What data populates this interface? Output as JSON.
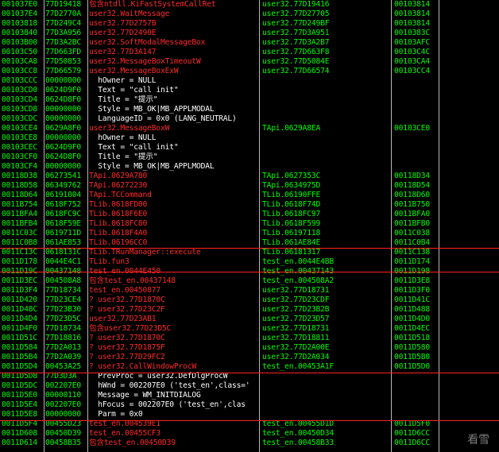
{
  "watermark": "看雪",
  "rows": [
    {
      "addr": "001037E0",
      "val": "77D19418",
      "com": "包含ntdll.KiFastSystemCallRet",
      "cc": "red",
      "proc": "user32.77D19416",
      "frame": "00103814"
    },
    {
      "addr": "001037E4",
      "val": "77D2770A",
      "com": "user32.WaitMessage",
      "cc": "red",
      "proc": "user32.77D27705",
      "frame": "00103814"
    },
    {
      "addr": "00103818",
      "val": "77D249C4",
      "com": "user32.77D2757B",
      "cc": "red",
      "proc": "user32.77D249BF",
      "frame": "00103814"
    },
    {
      "addr": "00103840",
      "val": "77D3A956",
      "com": "user32.77D2490E",
      "cc": "red",
      "proc": "user32.77D3A951",
      "frame": "0010383C"
    },
    {
      "addr": "00103B00",
      "val": "77D3A2BC",
      "com": "user32.SoftModalMessageBox",
      "cc": "red",
      "proc": "user32.77D3A2B7",
      "frame": "00103AFC"
    },
    {
      "addr": "00103C50",
      "val": "77D663FD",
      "com": "user32.77D3A147",
      "cc": "red",
      "proc": "user32.77D663F8",
      "frame": "00103C4C"
    },
    {
      "addr": "00103CA8",
      "val": "77D50853",
      "com": "user32.MessageBoxTimeoutW",
      "cc": "red",
      "proc": "user32.77D5084E",
      "frame": "00103CA4"
    },
    {
      "addr": "00103CC8",
      "val": "77D66579",
      "com": "user32.MessageBoxExW",
      "cc": "red",
      "proc": "user32.77D66574",
      "frame": "00103CC4"
    },
    {
      "addr": "00103CCC",
      "val": "00000000",
      "com": "  hOwner = NULL",
      "cc": "wht",
      "proc": "",
      "frame": ""
    },
    {
      "addr": "00103CD0",
      "val": "0624D9F0",
      "com": "  Text = \"call init\"",
      "cc": "wht",
      "proc": "",
      "frame": ""
    },
    {
      "addr": "00103CD4",
      "val": "0624D8F0",
      "com": "  Title = \"提示\"",
      "cc": "wht",
      "proc": "",
      "frame": ""
    },
    {
      "addr": "00103CD8",
      "val": "00000000",
      "com": "  Style = MB_OK|MB_APPLMODAL",
      "cc": "wht",
      "proc": "",
      "frame": ""
    },
    {
      "addr": "00103CDC",
      "val": "00000000",
      "com": "  LanguageID = 0x0 (LANG_NEUTRAL)",
      "cc": "wht",
      "proc": "",
      "frame": ""
    },
    {
      "addr": "00103CE4",
      "val": "0629A8F0",
      "com": "user32.MessageBoxW",
      "cc": "red",
      "proc": "TApi.0629A8EA",
      "frame": "00103CE0"
    },
    {
      "addr": "00103CE8",
      "val": "00000000",
      "com": "  hOwner = NULL",
      "cc": "wht",
      "proc": "",
      "frame": ""
    },
    {
      "addr": "00103CEC",
      "val": "0624D9F0",
      "com": "  Text = \"call init\"",
      "cc": "wht",
      "proc": "",
      "frame": ""
    },
    {
      "addr": "00103CF0",
      "val": "0624D8F0",
      "com": "  Title = \"提示\"",
      "cc": "wht",
      "proc": "",
      "frame": ""
    },
    {
      "addr": "00103CF4",
      "val": "00000000",
      "com": "  Style = MB_OK|MB_APPLMODAL",
      "cc": "wht",
      "proc": "",
      "frame": ""
    },
    {
      "addr": "00118D38",
      "val": "06273541",
      "com": "TApi.0629A780",
      "cc": "red",
      "proc": "TApi.0627353C",
      "frame": "00118D34"
    },
    {
      "addr": "00118D58",
      "val": "06349762",
      "com": "TApi.06272230",
      "cc": "red",
      "proc": "TApi.0634975D",
      "frame": "00118D54"
    },
    {
      "addr": "00118D64",
      "val": "06191004",
      "com": "TApi.TCCommand",
      "cc": "red",
      "proc": "TLib.06190FFE",
      "frame": "00118D60"
    },
    {
      "addr": "0011B754",
      "val": "0618F752",
      "com": "TLib.0618FD00",
      "cc": "red",
      "proc": "TLib.0618F74D",
      "frame": "0011B750"
    },
    {
      "addr": "0011BFA4",
      "val": "0618FC9C",
      "com": "TLib.0618F6E0",
      "cc": "red",
      "proc": "TLib.0618FC97",
      "frame": "0011BFA0"
    },
    {
      "addr": "0011BFB4",
      "val": "0618F59E",
      "com": "TLib.0618FC80",
      "cc": "red",
      "proc": "TLib.0618F599",
      "frame": "0011BFB0"
    },
    {
      "addr": "0011C03C",
      "val": "0619711D",
      "com": "TLib.0618F4A0",
      "cc": "red",
      "proc": "TLib.06197118",
      "frame": "0011C038"
    },
    {
      "addr": "0011C0B8",
      "val": "061AE853",
      "com": "TLib.06196CC0",
      "cc": "red",
      "proc": "TLib.061AE84E",
      "frame": "0011C0B4"
    },
    {
      "addr": "0011C13C",
      "val": "0618131C",
      "com": "TLib.TRunManager::execute",
      "cc": "red",
      "proc": "TLib.06181317",
      "frame": "0011C138"
    },
    {
      "addr": "0011D178",
      "val": "0044E4C1",
      "com": "TLib.fun3",
      "cc": "red",
      "proc": "test_en.0044E4BB",
      "frame": "0011D174"
    },
    {
      "addr": "0011D19C",
      "val": "00437148",
      "com": "test_en.0044E450",
      "cc": "red",
      "proc": "test_en.00437143",
      "frame": "0011D198"
    },
    {
      "addr": "0011D3EC",
      "val": "004508A8",
      "com": "包含test_en.00437148",
      "cc": "red",
      "proc": "test_en.004508A2",
      "frame": "0011D3E8"
    },
    {
      "addr": "0011D3F4",
      "val": "77D18734",
      "com": "test_en.00450877",
      "cc": "red",
      "proc": "user32.77D18731",
      "frame": "0011D3F0"
    },
    {
      "addr": "0011D420",
      "val": "77D23CE4",
      "com": "? user32.77D1870C",
      "cc": "red",
      "proc": "user32.77D23CDF",
      "frame": "0011D41C"
    },
    {
      "addr": "0011D48C",
      "val": "77D23B30",
      "com": "? user32.77D23C2F",
      "cc": "red",
      "proc": "user32.77D23B2B",
      "frame": "0011D488"
    },
    {
      "addr": "0011D4D4",
      "val": "77D23D5C",
      "com": "user32.77D23AB1",
      "cc": "red",
      "proc": "user32.77D23D57",
      "frame": "0011D4D0"
    },
    {
      "addr": "0011D4F0",
      "val": "77D18734",
      "com": "包含user32.77D23D5C",
      "cc": "red",
      "proc": "user32.77D18731",
      "frame": "0011D4EC"
    },
    {
      "addr": "0011D51C",
      "val": "77D18816",
      "com": "? user32.77D1870C",
      "cc": "red",
      "proc": "user32.77D18811",
      "frame": "0011D518"
    },
    {
      "addr": "0011D584",
      "val": "77D2A013",
      "com": "? user32.77D1875F",
      "cc": "red",
      "proc": "user32.77D2A00E",
      "frame": "0011D580"
    },
    {
      "addr": "0011D5B4",
      "val": "77D2A039",
      "com": "? user32.77D29FC2",
      "cc": "red",
      "proc": "user32.77D2A034",
      "frame": "0011D5B0"
    },
    {
      "addr": "0011D5D4",
      "val": "00453A25",
      "com": "? user32.CallWindowProcW",
      "cc": "red",
      "proc": "test_en.00453A1F",
      "frame": "0011D5D0"
    },
    {
      "addr": "0011D5D8",
      "val": "77D3D3A",
      "com": "  PrevProc = user32.DefDlgProcW",
      "cc": "wht",
      "proc": "",
      "frame": ""
    },
    {
      "addr": "0011D5DC",
      "val": "002207E0",
      "com": "  hWnd = 002207E0 ('test_en',class='",
      "cc": "wht",
      "proc": "",
      "frame": ""
    },
    {
      "addr": "0011D5E0",
      "val": "00000110",
      "com": "  Message = WM_INITDIALOG",
      "cc": "wht",
      "proc": "",
      "frame": ""
    },
    {
      "addr": "0011D5E4",
      "val": "002207E0",
      "com": "  hFocus = 002207E0 ('test_en',clas",
      "cc": "wht",
      "proc": "",
      "frame": ""
    },
    {
      "addr": "0011D5E8",
      "val": "00000000",
      "com": "  Parm = 0x0",
      "cc": "wht",
      "proc": "",
      "frame": ""
    },
    {
      "addr": "0011D5F4",
      "val": "00455D23",
      "com": "test_en.004539E1",
      "cc": "red",
      "proc": "test_en.00455D1D",
      "frame": "0011D5F0"
    },
    {
      "addr": "0011D608",
      "val": "00450D39",
      "com": "test_en.00455CF3",
      "cc": "red",
      "proc": "test_en.00450D34",
      "frame": "0011D6CC"
    },
    {
      "addr": "0011D614",
      "val": "00458B35",
      "com": "包含test_en.00450D39",
      "cc": "red",
      "proc": "test_en.00458B33",
      "frame": "0011D6CC"
    }
  ]
}
